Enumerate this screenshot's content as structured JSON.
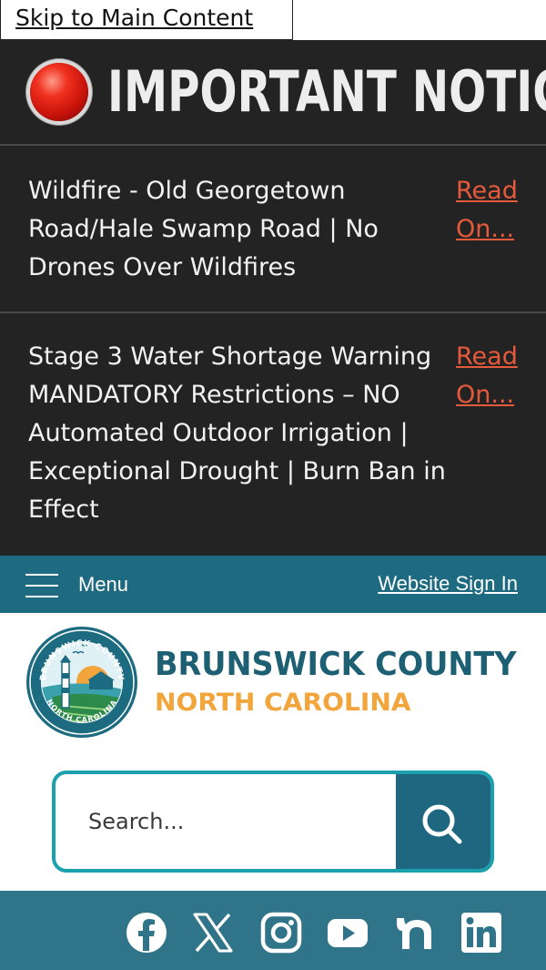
{
  "skip_link": "Skip to Main Content",
  "notice": {
    "title": "IMPORTANT NOTICES",
    "items": [
      {
        "text": "Wildfire - Old Georgetown Road/Hale Swamp Road | No Drones Over Wildfires",
        "link": "Read On..."
      },
      {
        "text": "Stage 3 Water Shortage Warning MANDATORY Restrictions – NO Automated Outdoor Irrigation | Exceptional Drought | Burn Ban in Effect",
        "link": "Read On..."
      }
    ]
  },
  "nav": {
    "menu_label": "Menu",
    "sign_in": "Website Sign In"
  },
  "logo": {
    "county": "BRUNSWICK COUNTY",
    "state": "NORTH CAROLINA",
    "seal_text": "BRUNSWICK COUNTY · NORTH CAROLINA"
  },
  "search": {
    "placeholder": "Search..."
  },
  "social": [
    "facebook-icon",
    "x-icon",
    "instagram-icon",
    "youtube-icon",
    "nextdoor-icon",
    "linkedin-icon"
  ],
  "colors": {
    "notice_bg": "#232323",
    "nav_teal": "#1e6a80",
    "social_teal": "#2f7488",
    "brand_blue": "#1d5f73",
    "brand_orange": "#f1a53a",
    "link_red": "#e55a3a",
    "search_border": "#1aa1ad"
  }
}
